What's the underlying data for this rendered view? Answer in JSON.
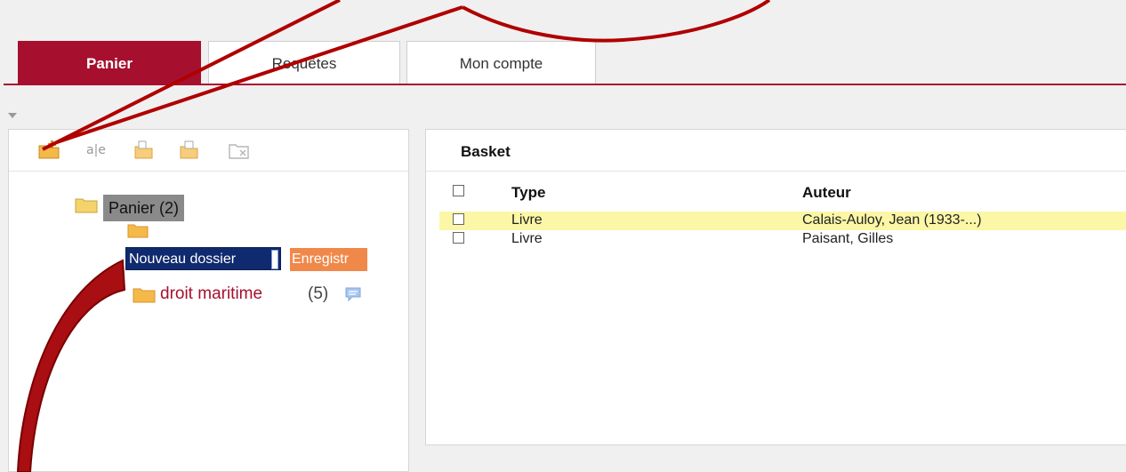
{
  "tabs": [
    {
      "label": "Panier",
      "active": true
    },
    {
      "label": "Requêtes",
      "active": false
    },
    {
      "label": "Mon compte",
      "active": false
    }
  ],
  "toolbar": {
    "icons": [
      "new-folder-icon",
      "rename-icon",
      "copy-folder-icon",
      "move-folder-icon",
      "delete-folder-icon"
    ]
  },
  "tree": {
    "root_label": "Panier (2)",
    "new_folder_input_value": "Nouveau dossier",
    "save_label": "Enregistr",
    "folder": {
      "name": "droit maritime",
      "count": "(5)"
    }
  },
  "basket": {
    "title": "Basket",
    "columns": {
      "type": "Type",
      "author": "Auteur"
    },
    "rows": [
      {
        "type": "Livre",
        "author": "Calais-Auloy, Jean (1933-...)",
        "highlighted": true
      },
      {
        "type": "Livre",
        "author": "Paisant, Gilles",
        "highlighted": false
      }
    ]
  },
  "colors": {
    "accent": "#a6102e",
    "highlight_row": "#fbf7a6",
    "folder": "#f5b94a",
    "save_button": "#f0884a",
    "annotation": "#b00000"
  }
}
